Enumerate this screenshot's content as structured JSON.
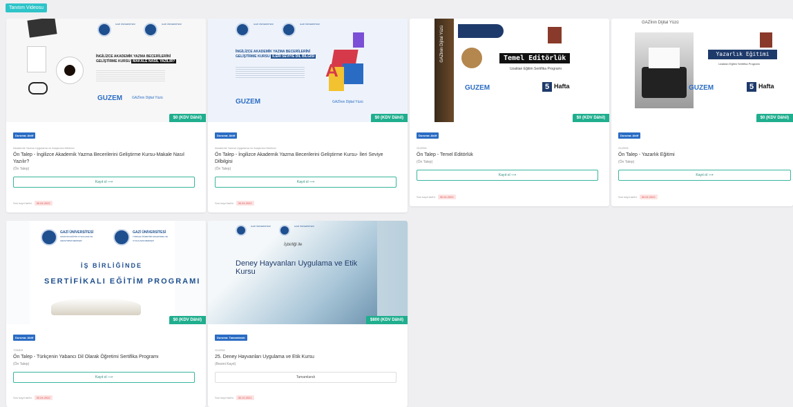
{
  "top_button": "Tanıtım Videosu",
  "cards": [
    {
      "price": "$0 (KDV Dâhil)",
      "status": "Duruma: Aktif",
      "unit": "Akademik Yazma Uygulama ve Araştırma Merkezi",
      "title": "Ön Talep - İngilizce Akademik Yazma Becerilerini Geliştirme Kursu-Makale Nasıl Yazılır?",
      "subtitle": "(Ön Talep)",
      "action": "Kayıt ol ⟶",
      "deadline_label": "Son kayıt tarihi:",
      "deadline": "30.04.2022",
      "thumb": {
        "heading": "İNGİLİZCE AKADEMİK YAZMA BECERİLERİNİ",
        "heading2": "GELİŞTİRME KURSU",
        "heading3": "MAKALE NASIL YAZILIR?",
        "brand": "GUZEM",
        "brand2": "GAZİnin Dijital Yüzü"
      }
    },
    {
      "price": "$0 (KDV Dâhil)",
      "status": "Duruma: Aktif",
      "unit": "Akademik Yazma Uygulama ve Araştırma Merkezi",
      "title": "Ön Talep - İngilizce Akademik Yazma Becerilerini Geliştirme Kursu- İleri Seviye Dilbilgisi",
      "subtitle": "(Ön Talep)",
      "action": "Kayıt ol ⟶",
      "deadline_label": "Son kayıt tarihi:",
      "deadline": "30.04.2022",
      "thumb": {
        "heading": "İNGİLİZCE AKADEMİK YAZMA BECERİLERİNİ",
        "heading2": "GELİŞTİRME KURSU",
        "heading3": "İLERİ SEVİYE DİL BİLGİSİ",
        "brand": "GUZEM",
        "brand2": "GAZİnin Dijital Yüzü"
      }
    },
    {
      "price": "$0 (KDV Dâhil)",
      "status": "Duruma: Aktif",
      "unit": "GUZEM",
      "title": "Ön Talep - Temel Editörlük",
      "subtitle": "(Ön Talep)",
      "action": "Kayıt ol ⟶",
      "deadline_label": "Son kayıt tarihi:",
      "deadline": "30.04.2022",
      "thumb": {
        "heading": "Temel Editörlük",
        "sub": "Uzaktan Eğitim Sertifika Programı",
        "weeks_num": "5",
        "weeks": "Hafta",
        "brand": "GUZEM",
        "side": "GAZİnin Dijital Yüzü"
      }
    },
    {
      "price": "$0 (KDV Dâhil)",
      "status": "Duruma: Aktif",
      "unit": "GUZEM",
      "title": "Ön Talep - Yazarlık Eğitimi",
      "subtitle": "(Ön Talep)",
      "action": "Kayıt ol ⟶",
      "deadline_label": "Son kayıt tarihi:",
      "deadline": "30.04.2022",
      "thumb": {
        "heading": "Yazarlık Eğitimi",
        "sub": "Uzaktan Eğitim Sertifika Programı",
        "weeks_num": "5",
        "weeks": "Hafta",
        "brand": "GUZEM",
        "top": "GAZİnin Dijital Yüzü"
      }
    },
    {
      "price": "$0 (KDV Dâhil)",
      "status": "Duruma: Aktif",
      "unit": "TÖMER",
      "title": "Ön Talep - Türkçenin Yabancı Dil Olarak Öğretimi Sertifika Programı",
      "subtitle": "(Ön Talep)",
      "action": "Kayıt ol ⟶",
      "deadline_label": "Son kayıt tarihi:",
      "deadline": "30.04.2022",
      "thumb": {
        "uni1": "GAZİ ÜNİVERSİTESİ",
        "uni1_sub": "UZAKTAN EĞİTİM UYGULAMA VE ARAŞTIRMA MERKEZİ",
        "uni2": "GAZİ ÜNİVERSİTESİ",
        "uni2_sub": "TÜRKÇE ÖĞRETİMİ ARAŞTIRMA VE UYGULAMA MERKEZİ",
        "line1": "İŞ BİRLİĞİNDE",
        "line2": "SERTİFİKALI EĞİTİM PROGRAMI"
      }
    },
    {
      "price": "$800 (KDV Dâhil)",
      "status": "Duruma: Tamamlandı",
      "unit": "GUZEM",
      "title": "25. Deney Hayvanları Uygulama ve Etik Kursu",
      "subtitle": "(Resmi Kayıt)",
      "action": "Tamamlandı",
      "deadline_label": "Son kayıt tarihi:",
      "deadline": "30.10.2021",
      "thumb": {
        "cooperation": "İşbirliği ile",
        "heading": "Deney Hayvanları Uygulama ve Etik Kursu"
      }
    }
  ]
}
